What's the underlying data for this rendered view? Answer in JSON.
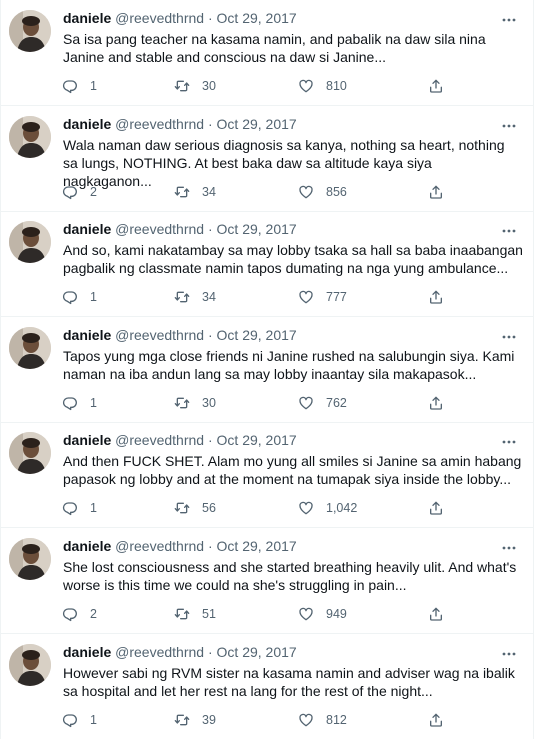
{
  "tweets": [
    {
      "name": "daniele",
      "handle": "@reevedthrnd",
      "date": "Oct 29, 2017",
      "text": "Sa isa pang teacher na kasama namin, and pabalik na daw sila nina Janine and stable and conscious na daw si Janine...",
      "replies": "1",
      "retweets": "30",
      "likes": "810"
    },
    {
      "name": "daniele",
      "handle": "@reevedthrnd",
      "date": "Oct 29, 2017",
      "text": "Wala naman daw serious diagnosis sa kanya, nothing sa heart, nothing sa lungs, NOTHING. At best baka daw sa altitude kaya siya nagkaganon...",
      "replies": "2",
      "retweets": "34",
      "likes": "856"
    },
    {
      "name": "daniele",
      "handle": "@reevedthrnd",
      "date": "Oct 29, 2017",
      "text": "And so, kami nakatambay sa may lobby tsaka sa hall sa baba inaabangan pagbalik ng classmate namin tapos dumating na nga yung ambulance...",
      "replies": "1",
      "retweets": "34",
      "likes": "777"
    },
    {
      "name": "daniele",
      "handle": "@reevedthrnd",
      "date": "Oct 29, 2017",
      "text": "Tapos yung mga close friends ni Janine rushed na salubungin siya. Kami naman na iba andun lang sa may lobby inaantay sila makapasok...",
      "replies": "1",
      "retweets": "30",
      "likes": "762"
    },
    {
      "name": "daniele",
      "handle": "@reevedthrnd",
      "date": "Oct 29, 2017",
      "text": "And then FUCK SHET. Alam mo yung all smiles si Janine sa amin habang papasok ng lobby and at the moment na tumapak siya inside the lobby...",
      "replies": "1",
      "retweets": "56",
      "likes": "1,042"
    },
    {
      "name": "daniele",
      "handle": "@reevedthrnd",
      "date": "Oct 29, 2017",
      "text": "She lost consciousness and she started breathing heavily ulit. And what's worse is this time we could na she's struggling in pain...",
      "replies": "2",
      "retweets": "51",
      "likes": "949"
    },
    {
      "name": "daniele",
      "handle": "@reevedthrnd",
      "date": "Oct 29, 2017",
      "text": "However sabi ng RVM sister na kasama namin and adviser wag na ibalik sa hospital and let her rest na lang for the rest of the night...",
      "replies": "1",
      "retweets": "39",
      "likes": "812"
    }
  ],
  "separator": "·",
  "icons": {
    "reply": "reply-icon",
    "retweet": "retweet-icon",
    "like": "heart-icon",
    "share": "share-icon",
    "more": "more-icon"
  },
  "colors": {
    "text": "#0f1419",
    "secondary": "#536471",
    "border": "#eff3f4"
  }
}
